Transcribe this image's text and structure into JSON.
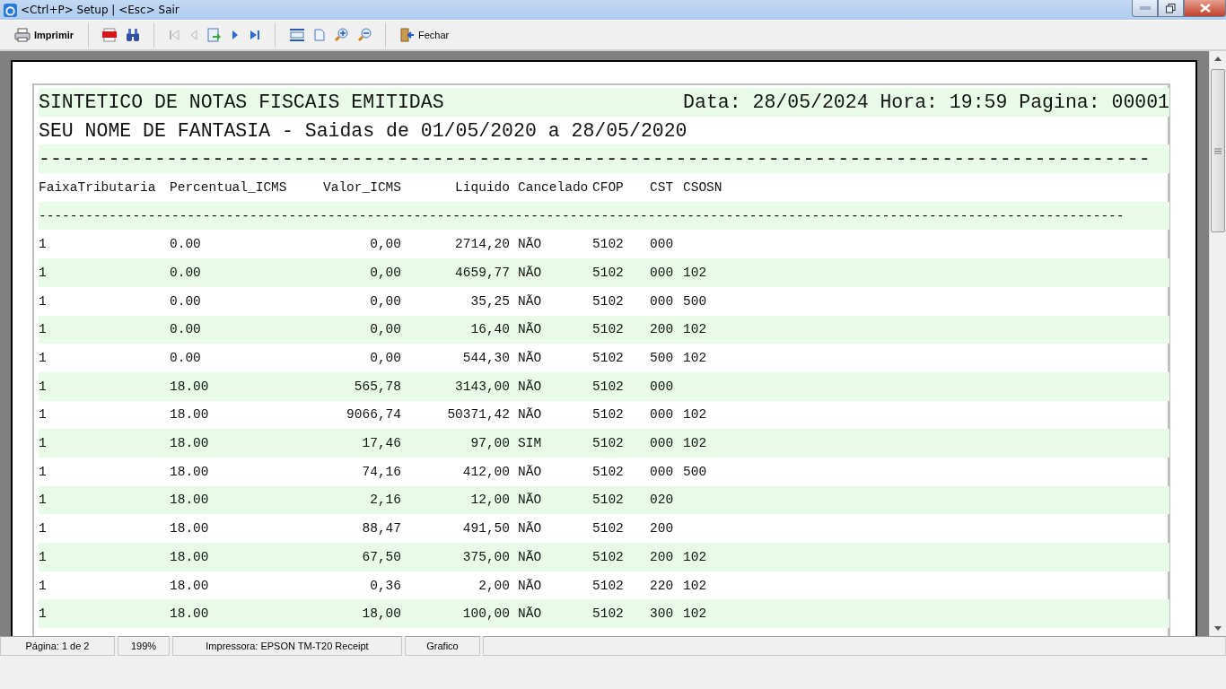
{
  "window": {
    "title": "<Ctrl+P> Setup | <Esc> Sair"
  },
  "toolbar": {
    "groups": [
      [
        {
          "kind": "print",
          "label": "Imprimir"
        }
      ],
      [
        {
          "kind": "pdf"
        },
        {
          "kind": "find"
        }
      ],
      [
        {
          "kind": "first",
          "disabled": true
        },
        {
          "kind": "prev",
          "disabled": true
        },
        {
          "kind": "goto",
          "disabled": false
        },
        {
          "kind": "next",
          "disabled": false
        },
        {
          "kind": "last",
          "disabled": false
        }
      ],
      [
        {
          "kind": "page-width"
        },
        {
          "kind": "whole-page"
        },
        {
          "kind": "zoom-in"
        },
        {
          "kind": "zoom-out"
        }
      ],
      [
        {
          "kind": "close",
          "label": "Fechar"
        }
      ]
    ]
  },
  "report": {
    "title": "SINTETICO DE NOTAS FISCAIS EMITIDAS",
    "header_info": "Data: 28/05/2024 Hora: 19:59 Pagina: 00001",
    "subtitle": "SEU NOME DE FANTASIA - Saidas de 01/05/2020 a 28/05/2020",
    "rule_wide": "------------------------------------------------------------------------------------------------",
    "rule_narrow": "-------------------------------------------------------------------------------------------------------------------------------------------",
    "columns": [
      "FaixaTributaria",
      "Percentual_ICMS",
      "Valor_ICMS",
      "Liquido",
      "Cancelado",
      "CFOP",
      "CST",
      "CSOSN"
    ],
    "rows": [
      [
        "1",
        "0.00",
        "0,00",
        "2714,20",
        "NÃO",
        "5102",
        "000",
        ""
      ],
      [
        "1",
        "0.00",
        "0,00",
        "4659,77",
        "NÃO",
        "5102",
        "000",
        "102"
      ],
      [
        "1",
        "0.00",
        "0,00",
        "35,25",
        "NÃO",
        "5102",
        "000",
        "500"
      ],
      [
        "1",
        "0.00",
        "0,00",
        "16,40",
        "NÃO",
        "5102",
        "200",
        "102"
      ],
      [
        "1",
        "0.00",
        "0,00",
        "544,30",
        "NÃO",
        "5102",
        "500",
        "102"
      ],
      [
        "1",
        "18.00",
        "565,78",
        "3143,00",
        "NÃO",
        "5102",
        "000",
        ""
      ],
      [
        "1",
        "18.00",
        "9066,74",
        "50371,42",
        "NÃO",
        "5102",
        "000",
        "102"
      ],
      [
        "1",
        "18.00",
        "17,46",
        "97,00",
        "SIM",
        "5102",
        "000",
        "102"
      ],
      [
        "1",
        "18.00",
        "74,16",
        "412,00",
        "NÃO",
        "5102",
        "000",
        "500"
      ],
      [
        "1",
        "18.00",
        "2,16",
        "12,00",
        "NÃO",
        "5102",
        "020",
        ""
      ],
      [
        "1",
        "18.00",
        "88,47",
        "491,50",
        "NÃO",
        "5102",
        "200",
        ""
      ],
      [
        "1",
        "18.00",
        "67,50",
        "375,00",
        "NÃO",
        "5102",
        "200",
        "102"
      ],
      [
        "1",
        "18.00",
        "0,36",
        "2,00",
        "NÃO",
        "5102",
        "220",
        "102"
      ],
      [
        "1",
        "18.00",
        "18,00",
        "100,00",
        "NÃO",
        "5102",
        "300",
        "102"
      ]
    ]
  },
  "status_bar": [
    "Página: 1 de 2",
    "199%",
    "Impressora: EPSON TM-T20 Receipt",
    "Grafico"
  ]
}
